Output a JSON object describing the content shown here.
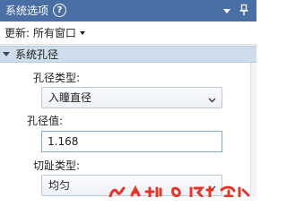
{
  "panel": {
    "title": "系统选项",
    "help_symbol": "?"
  },
  "update": {
    "label": "更新: 所有窗口"
  },
  "section": {
    "title": "系统孔径"
  },
  "aperture_type": {
    "label": "孔径类型:",
    "value": "入瞳直径"
  },
  "aperture_value": {
    "label": "孔径值:",
    "value": "1.168"
  },
  "apodization_type": {
    "label": "切趾类型:",
    "value": "均匀"
  },
  "icons": {
    "help": "help-circle-icon",
    "dropdown": "dropdown-arrow-icon",
    "pin": "pin-icon",
    "collapse": "collapse-triangle-icon",
    "combo_arrow": "chevron-down-icon"
  },
  "colors": {
    "titlebar": "#4a6fa5",
    "section_header": "#cfdcec",
    "watermark": "#e2362b"
  }
}
